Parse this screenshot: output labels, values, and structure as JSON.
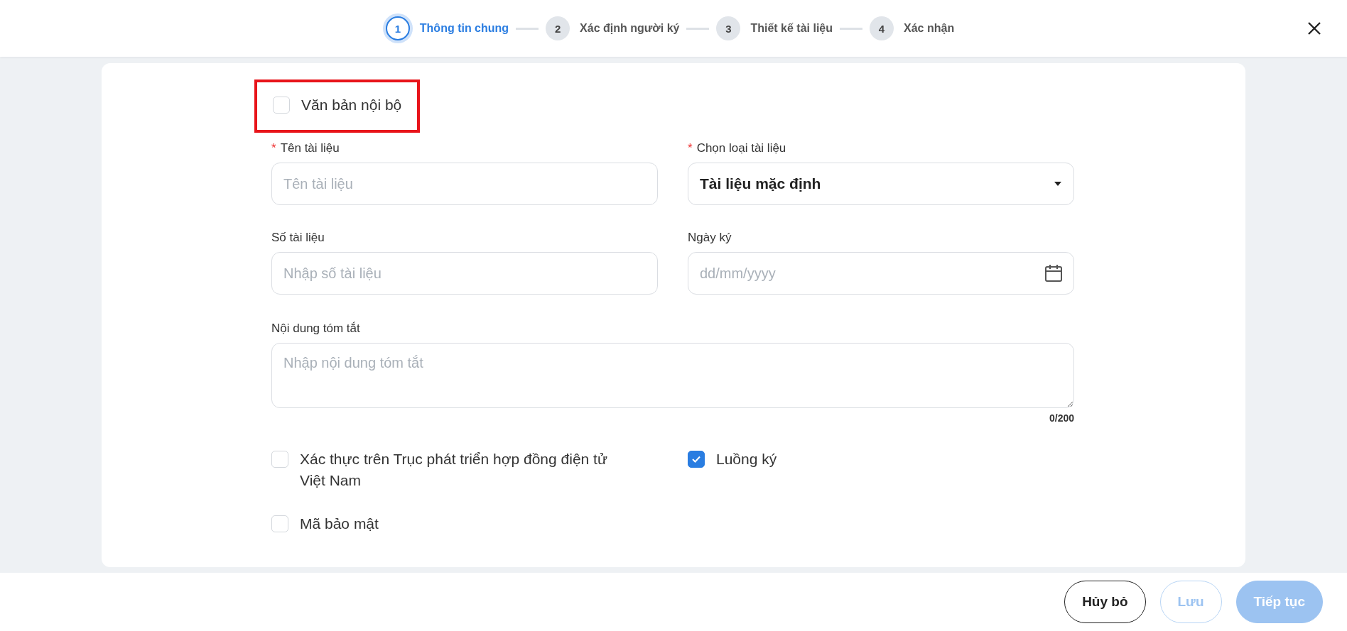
{
  "steps": [
    {
      "number": "1",
      "label": "Thông tin chung",
      "selected": true
    },
    {
      "number": "2",
      "label": "Xác định người ký",
      "selected": false
    },
    {
      "number": "3",
      "label": "Thiết kế tài liệu",
      "selected": false
    },
    {
      "number": "4",
      "label": "Xác nhận",
      "selected": false
    }
  ],
  "internal_doc": {
    "label": "Văn bản nội bộ",
    "checked": false,
    "highlighted": true
  },
  "fields": [
    {
      "kind": "text",
      "required_mark": "*",
      "label": "Tên tài liệu",
      "placeholder": "Tên tài liệu"
    },
    {
      "kind": "select",
      "required_mark": "*",
      "label": "Chọn loại tài liệu",
      "value": "Tài liệu mặc định"
    },
    {
      "kind": "text",
      "label": "Số tài liệu",
      "placeholder": "Nhập số tài liệu"
    },
    {
      "kind": "date",
      "label": "Ngày ký",
      "placeholder": "dd/mm/yyyy"
    }
  ],
  "summary": {
    "label": "Nội dung tóm tắt",
    "placeholder": "Nhập nội dung tóm tắt",
    "counter": "0/200"
  },
  "options": [
    {
      "label": "Xác thực trên Trục phát triển hợp đồng điện tử Việt Nam",
      "checked": false
    },
    {
      "label": "Luồng ký",
      "checked": true
    },
    {
      "label": "Mã bảo mật",
      "checked": false
    }
  ],
  "buttons": [
    {
      "kind": "outline",
      "label": "Hủy bỏ",
      "disabled": false
    },
    {
      "kind": "outline",
      "label": "Lưu",
      "disabled": true
    },
    {
      "kind": "primary",
      "label": "Tiếp tục",
      "disabled": true
    }
  ]
}
